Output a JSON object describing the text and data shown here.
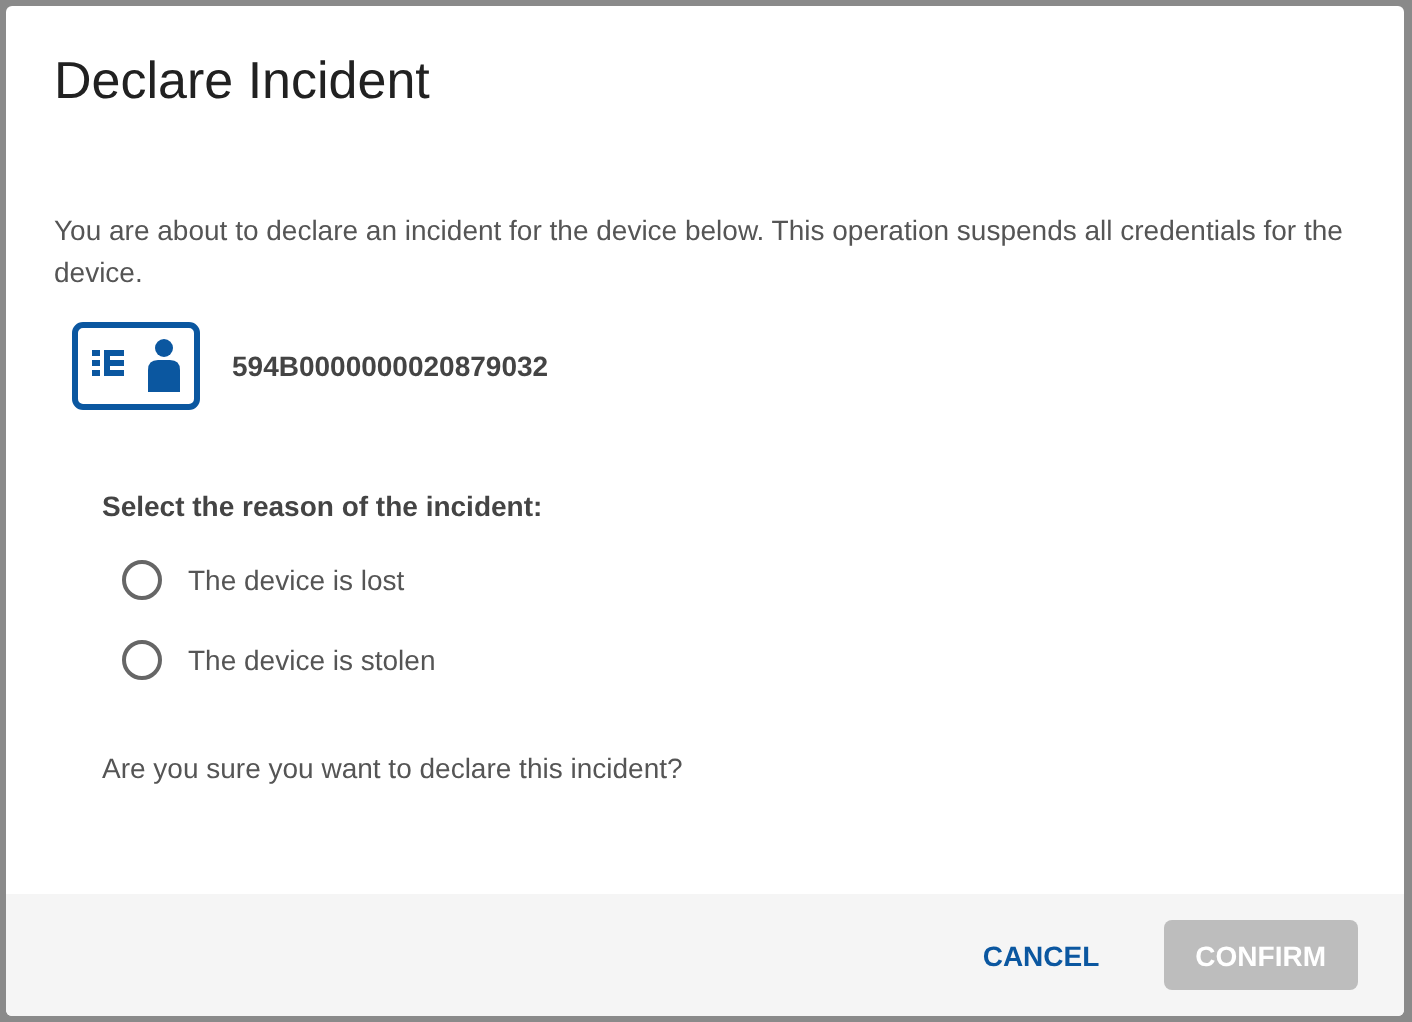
{
  "dialog": {
    "title": "Declare Incident",
    "message": "You are about to declare an incident for the device below. This operation suspends all credentials for the device.",
    "device": {
      "id": "594B0000000020879032"
    },
    "reason_label": "Select the reason of the incident:",
    "reasons": [
      {
        "label": "The device is lost",
        "selected": false
      },
      {
        "label": "The device is stolen",
        "selected": false
      }
    ],
    "question": "Are you sure you want to declare this incident?",
    "buttons": [
      {
        "label": "CANCEL",
        "kind": "text",
        "disabled": false
      },
      {
        "label": "CONFIRM",
        "kind": "filled",
        "disabled": true
      }
    ]
  }
}
